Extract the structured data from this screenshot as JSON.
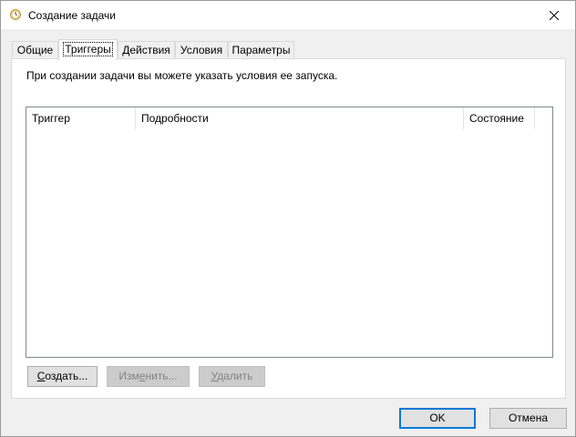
{
  "window": {
    "title": "Создание задачи",
    "close_glyph": "✕"
  },
  "tabs": [
    {
      "label": "Общие",
      "active": false
    },
    {
      "label": "Триггеры",
      "active": true
    },
    {
      "label": "Действия",
      "active": false
    },
    {
      "label": "Условия",
      "active": false
    },
    {
      "label": "Параметры",
      "active": false
    }
  ],
  "triggers_tab": {
    "description": "При создании задачи вы можете указать условия ее запуска.",
    "columns": [
      "Триггер",
      "Подробности",
      "Состояние"
    ],
    "rows": []
  },
  "buttons": {
    "create": {
      "pre": "",
      "accel": "С",
      "post": "оздать...",
      "enabled": true
    },
    "edit": {
      "pre": "Изм",
      "accel": "е",
      "post": "нить...",
      "enabled": false
    },
    "delete": {
      "pre": "",
      "accel": "У",
      "post": "далить",
      "enabled": false
    }
  },
  "footer": {
    "ok_label": "OK",
    "cancel_label": "Отмена"
  },
  "colors": {
    "accent": "#0078d7",
    "clock_icon": "#e8b23a"
  },
  "icons": {
    "title": "clock-icon",
    "close": "close-icon"
  }
}
